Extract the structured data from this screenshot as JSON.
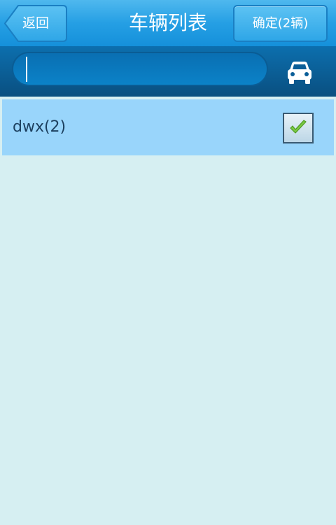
{
  "header": {
    "back_label": "返回",
    "title": "车辆列表",
    "confirm_label": "确定(2辆)"
  },
  "search": {
    "value": "",
    "placeholder": "",
    "vehicle_button_icon": "car-icon"
  },
  "vehicles": [
    {
      "name": "dwx(2)",
      "checked": true
    }
  ],
  "colors": {
    "header_blue": "#259fe4",
    "search_bar_dark": "#0a4f80",
    "selected_row": "#99d5fb",
    "page_background": "#d6eff2",
    "check_green": "#7ac943"
  }
}
